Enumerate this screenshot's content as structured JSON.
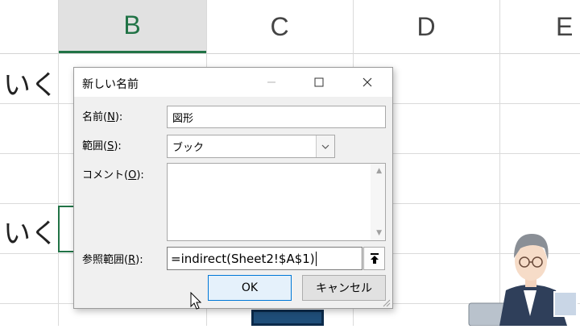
{
  "sheet": {
    "columns": [
      "B",
      "C",
      "D",
      "E"
    ],
    "cells": [
      "いく",
      "いく"
    ]
  },
  "dialog": {
    "title": "新しい名前",
    "name_label_prefix": "名前(",
    "name_label_key": "N",
    "name_label_suffix": "):",
    "name_value": "図形",
    "scope_label_prefix": "範囲(",
    "scope_label_key": "S",
    "scope_label_suffix": "):",
    "scope_value": "ブック",
    "comment_label_prefix": "コメント(",
    "comment_label_key": "O",
    "comment_label_suffix": "):",
    "comment_value": "",
    "refers_label_prefix": "参照範囲(",
    "refers_label_key": "R",
    "refers_label_suffix": "):",
    "refers_value": "=indirect(Sheet2!$A$1)",
    "ok_label": "OK",
    "cancel_label": "キャンセル"
  },
  "icons": {
    "minimize": "minimize-icon",
    "maximize": "maximize-icon",
    "close": "close-icon",
    "dropdown": "chevron-down-icon",
    "collapse": "collapse-dialog-icon",
    "cursor": "mouse-pointer-icon"
  },
  "colors": {
    "excel_green": "#217346",
    "ok_border": "#0078d7",
    "shape_fill": "#1f4e79"
  }
}
